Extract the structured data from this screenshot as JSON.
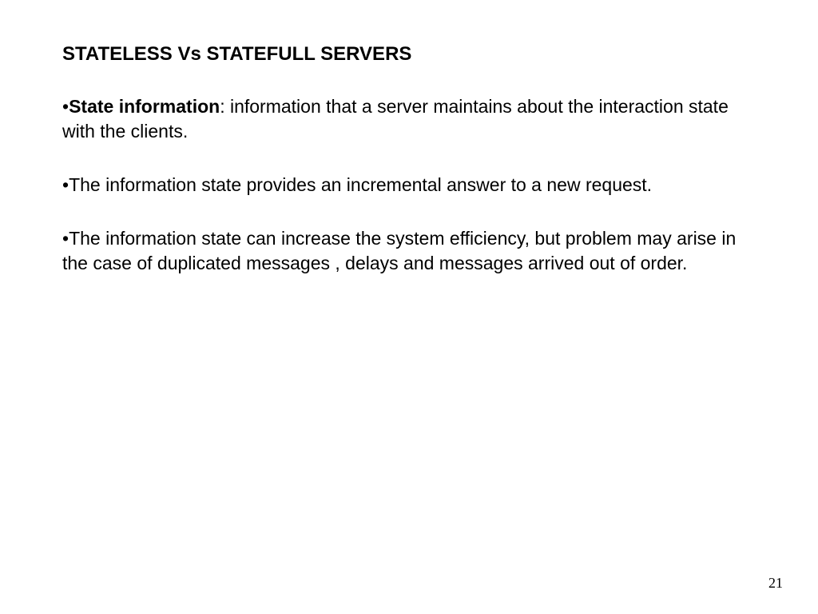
{
  "slide": {
    "title": "STATELESS Vs STATEFULL SERVERS",
    "bullets": [
      {
        "label": "State information",
        "text": ": information that a server maintains about the interaction state with the clients."
      },
      {
        "label": "",
        "text": "The information state provides an incremental answer to a new request."
      },
      {
        "label": "",
        "text": "The information state  can increase the system efficiency, but problem may arise in the case of duplicated messages , delays and messages arrived out of order."
      }
    ],
    "page_number": "21"
  }
}
